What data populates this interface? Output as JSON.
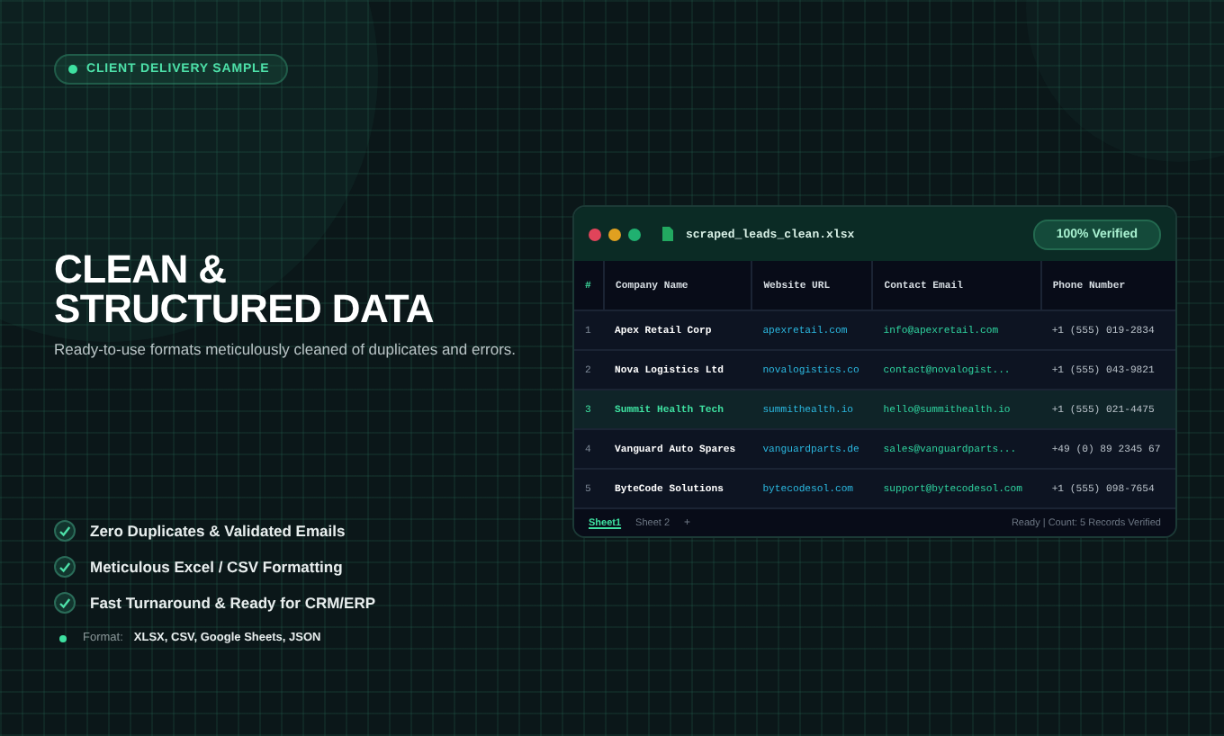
{
  "badge": {
    "label": "CLIENT DELIVERY SAMPLE"
  },
  "heading": [
    "CLEAN &",
    "STRUCTURED DATA"
  ],
  "subtitle": "Ready-to-use formats meticulously cleaned of duplicates and errors.",
  "spreadsheet": {
    "filename": "scraped_leads_clean.xlsx",
    "verified": "100% Verified",
    "columns": [
      "#",
      "Company Name",
      "Website URL",
      "Contact Email",
      "Phone Number"
    ],
    "rows": [
      {
        "number": "1",
        "company": "Apex Retail Corp",
        "website": "apexretail.com",
        "email": "info@apexretail.com",
        "phone": "+1 (555) 019-2834",
        "selected": false
      },
      {
        "number": "2",
        "company": "Nova Logistics Ltd",
        "website": "novalogistics.co",
        "email": "contact@novalogist...",
        "phone": "+1 (555) 043-9821",
        "selected": false
      },
      {
        "number": "3",
        "company": "Summit Health Tech",
        "website": "summithealth.io",
        "email": "hello@summithealth.io",
        "phone": "+1 (555) 021-4475",
        "selected": true
      },
      {
        "number": "4",
        "company": "Vanguard Auto Spares",
        "website": "vanguardparts.de",
        "email": "sales@vanguardparts...",
        "phone": "+49 (0) 89 2345 67",
        "selected": false
      },
      {
        "number": "5",
        "company": "ByteCode Solutions",
        "website": "bytecodesol.com",
        "email": "support@bytecodesol.com",
        "phone": "+1 (555) 098-7654",
        "selected": false
      }
    ],
    "sheets": [
      {
        "label": "Sheet1",
        "selected": true
      },
      {
        "label": "Sheet 2",
        "selected": false
      }
    ],
    "add_sheet": "+",
    "status": "Ready | Count: 5 Records Verified"
  },
  "features": [
    "Zero Duplicates & Validated Emails",
    "Meticulous Excel / CSV Formatting",
    "Fast Turnaround & Ready for CRM/ERP"
  ],
  "format": {
    "label": "Format:",
    "value": "XLSX, CSV, Google Sheets, JSON"
  }
}
